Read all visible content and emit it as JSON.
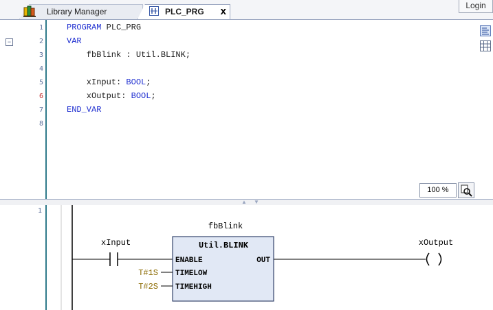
{
  "tabs": [
    {
      "label": "Library Manager",
      "icon": "library-icon",
      "active": false
    },
    {
      "label": "PLC_PRG",
      "icon": "pou-icon",
      "active": true
    }
  ],
  "tab_close": "x",
  "login_button": "Login",
  "declaration": {
    "line_numbers": [
      "1",
      "2",
      "3",
      "4",
      "5",
      "6",
      "7",
      "8"
    ],
    "fold_toggle": "−",
    "lines": [
      {
        "kw": "PROGRAM",
        "rest": " PLC_PRG"
      },
      {
        "kw": "VAR",
        "rest": ""
      },
      {
        "kw": "",
        "rest": "    fbBlink : Util.BLINK;"
      },
      {
        "kw": "",
        "rest": ""
      },
      {
        "pre": "    xInput: ",
        "kw": "BOOL",
        "rest": ";"
      },
      {
        "pre": "    xOutput: ",
        "kw": "BOOL",
        "rest": ";"
      },
      {
        "kw": "END_VAR",
        "rest": ""
      },
      {
        "kw": "",
        "rest": ""
      }
    ],
    "zoom_level": "100 %"
  },
  "network": {
    "number": "1",
    "instance_name": "fbBlink",
    "fb_type": "Util.BLINK",
    "inputs": [
      "ENABLE",
      "TIMELOW",
      "TIMEHIGH"
    ],
    "output": "OUT",
    "contact_var": "xInput",
    "coil_var": "xOutput",
    "timelow_value": "T#1S",
    "timehigh_value": "T#2S"
  },
  "colors": {
    "keyword": "#1f2fd0",
    "constant": "#8b6a00",
    "fb_fill": "#e1e8f5",
    "fb_border": "#34446b",
    "gutter_line": "#2e7a8a"
  }
}
